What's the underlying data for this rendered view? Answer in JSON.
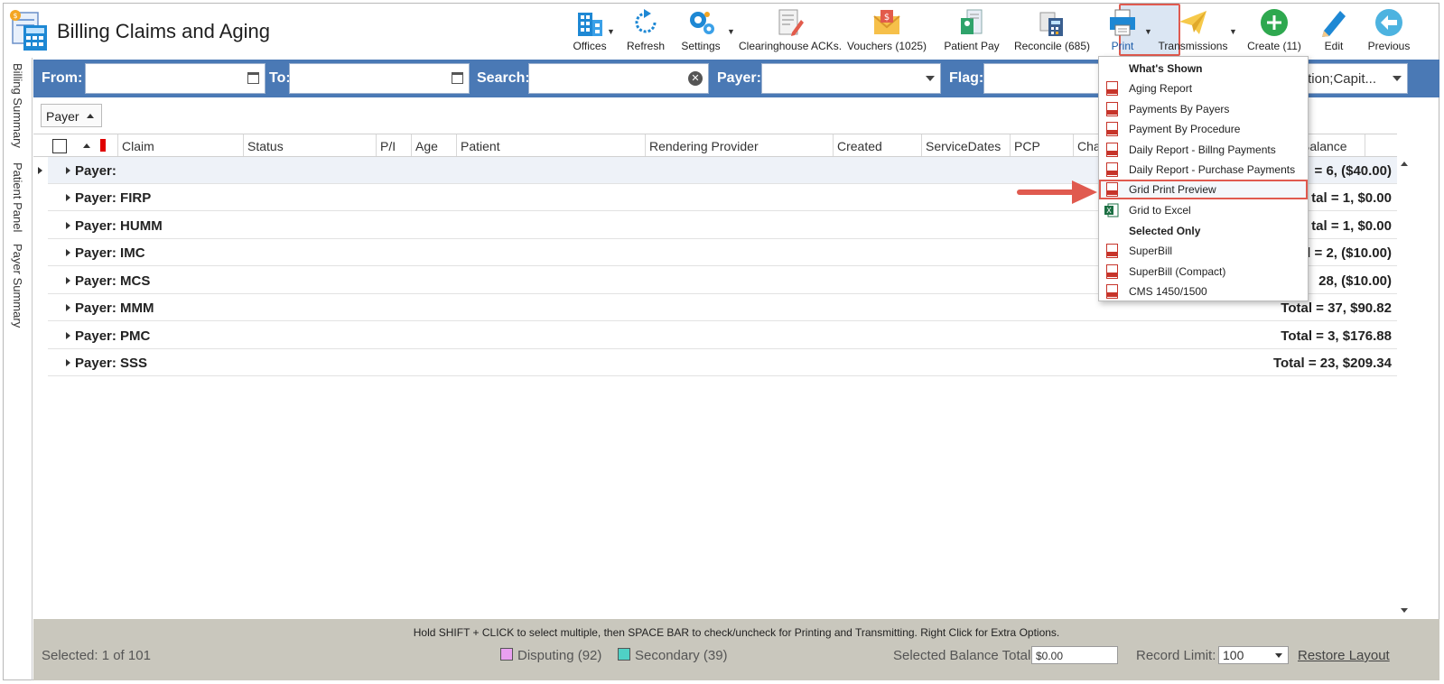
{
  "app": {
    "title": "Billing Claims and Aging"
  },
  "toolbar": [
    {
      "id": "offices",
      "label": "Offices",
      "icon": "offices-icon"
    },
    {
      "id": "refresh",
      "label": "Refresh",
      "icon": "refresh-icon"
    },
    {
      "id": "settings",
      "label": "Settings",
      "icon": "settings-gear-icon"
    },
    {
      "id": "clearinghouse",
      "label": "Clearinghouse ACKs.",
      "icon": "document-pencil-icon"
    },
    {
      "id": "vouchers",
      "label": "Vouchers (1025)",
      "icon": "envelope-money-icon"
    },
    {
      "id": "patient_pay",
      "label": "Patient Pay",
      "icon": "patient-pay-icon"
    },
    {
      "id": "reconcile",
      "label": "Reconcile (685)",
      "icon": "calculator-icon"
    },
    {
      "id": "print",
      "label": "Print",
      "icon": "printer-icon"
    },
    {
      "id": "transmissions",
      "label": "Transmissions",
      "icon": "paper-plane-icon"
    },
    {
      "id": "create",
      "label": "Create (11)",
      "icon": "plus-circle-icon"
    },
    {
      "id": "edit",
      "label": "Edit",
      "icon": "pencil-icon"
    },
    {
      "id": "previous",
      "label": "Previous",
      "icon": "back-arrow-icon"
    }
  ],
  "side_tabs": [
    "Billing Summary",
    "Patient Panel",
    "Payer Summary"
  ],
  "filter": {
    "from_label": "From:",
    "to_label": "To:",
    "search_label": "Search:",
    "payer_label": "Payer:",
    "flag_label": "Flag:",
    "flag_value": "ation;Capit..."
  },
  "group_chip": {
    "label": "Payer"
  },
  "columns": [
    "Claim",
    "Status",
    "P/I",
    "Age",
    "Patient",
    "Rendering Provider",
    "Created",
    "ServiceDates",
    "PCP",
    "Cha",
    "Balance"
  ],
  "groups": [
    {
      "name": "Payer:",
      "total": "= 6,  ($40.00)"
    },
    {
      "name": "Payer: FIRP",
      "total": "tal = 1,  $0.00"
    },
    {
      "name": "Payer: HUMM",
      "total": "tal = 1,  $0.00"
    },
    {
      "name": "Payer: IMC",
      "total": "tal = 2,  ($10.00)"
    },
    {
      "name": "Payer: MCS",
      "total": "28,  ($10.00)"
    },
    {
      "name": "Payer: MMM",
      "total": "Total = 37,  $90.82"
    },
    {
      "name": "Payer: PMC",
      "total": "Total = 3,  $176.88"
    },
    {
      "name": "Payer: SSS",
      "total": "Total = 23,  $209.34"
    }
  ],
  "print_menu": {
    "items": [
      {
        "label": "What's Shown",
        "kind": "header"
      },
      {
        "label": "Aging Report",
        "kind": "pdf"
      },
      {
        "label": "Payments By Payers",
        "kind": "pdf"
      },
      {
        "label": "Payment By Procedure",
        "kind": "pdf"
      },
      {
        "label": "Daily Report - Billng Payments",
        "kind": "pdf"
      },
      {
        "label": "Daily Report - Purchase Payments",
        "kind": "pdf"
      },
      {
        "label": "Grid Print Preview",
        "kind": "pdf",
        "highlighted": true
      },
      {
        "label": "Grid to Excel",
        "kind": "excel"
      },
      {
        "label": "Selected Only",
        "kind": "header"
      },
      {
        "label": "SuperBill",
        "kind": "pdf"
      },
      {
        "label": "SuperBill (Compact)",
        "kind": "pdf"
      },
      {
        "label": "CMS 1450/1500",
        "kind": "pdf"
      }
    ]
  },
  "footer": {
    "hint": "Hold SHIFT + CLICK to select multiple, then SPACE BAR to check/uncheck for Printing and Transmitting. Right Click for Extra Options.",
    "selected": "Selected: 1 of 101",
    "disputing": "Disputing (92)",
    "secondary": "Secondary (39)",
    "balance_label": "Selected Balance Total:",
    "balance_value": "$0.00",
    "record_limit_label": "Record Limit:",
    "record_limit_value": "100",
    "restore": "Restore Layout"
  },
  "colors": {
    "filter_bar": "#4a79b5",
    "footer": "#c9c7bd",
    "highlight": "#e05a4f",
    "disputing": "#e9a0f0",
    "secondary": "#4fd1c5"
  }
}
